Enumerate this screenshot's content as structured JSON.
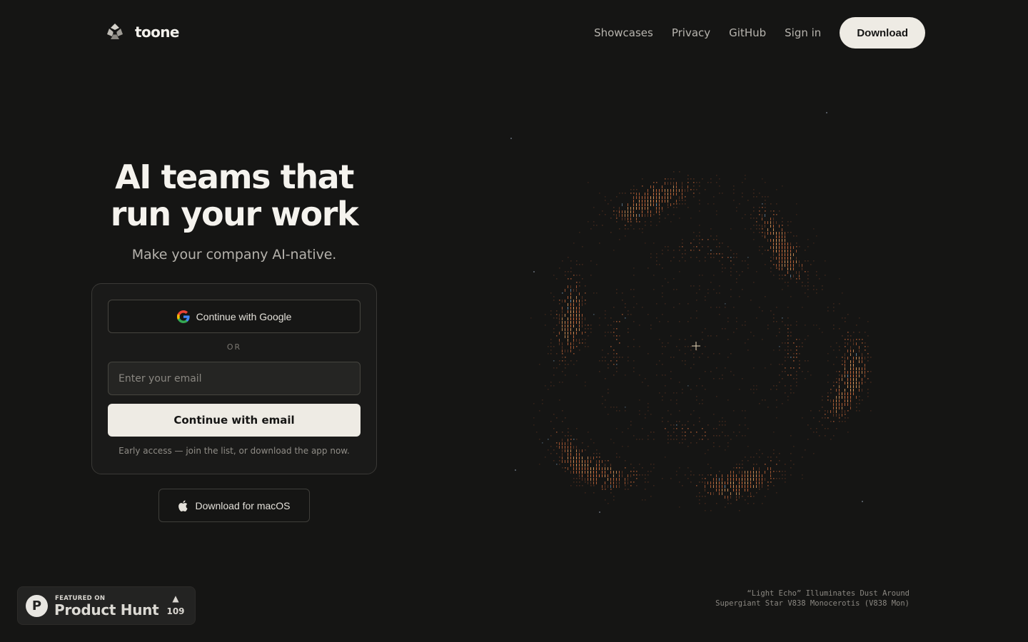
{
  "brand": {
    "name": "toone",
    "logo_icon": "aperture-logo-icon"
  },
  "nav": {
    "links": [
      "Showcases",
      "Privacy",
      "GitHub",
      "Sign in"
    ],
    "download_label": "Download"
  },
  "hero": {
    "title_line1": "AI teams that",
    "title_line2": "run your work",
    "subtitle": "Make your company AI-native."
  },
  "auth": {
    "google_label": "Continue with Google",
    "google_icon": "google-icon",
    "divider": "OR",
    "email_placeholder": "Enter your email",
    "email_value": "",
    "email_button": "Continue with email",
    "note": "Early access — join the list, or download the app now."
  },
  "mac_download": {
    "label": "Download for macOS",
    "icon": "apple-icon"
  },
  "product_hunt": {
    "kicker": "FEATURED ON",
    "name": "Product Hunt",
    "logo": "P",
    "arrow": "▲",
    "count": "109"
  },
  "artwork": {
    "caption_line1": "“Light Echo” Illuminates Dust Around",
    "caption_line2": "Supergiant Star V838 Monocerotis (V838 Mon)",
    "colors": {
      "warm": "#c8683a",
      "amber": "#d9955a",
      "dim": "#6a3a24",
      "cool": "#6f8fa8"
    }
  },
  "colors": {
    "background": "#151514",
    "button_light": "#eeebe4",
    "text_primary": "#f5f3ee",
    "text_muted": "#b5b2ac"
  }
}
